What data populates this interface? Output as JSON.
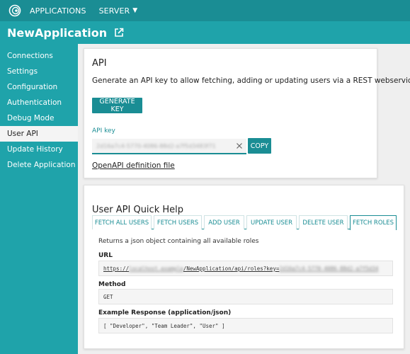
{
  "topbar": {
    "nav": [
      {
        "label": "APPLICATIONS"
      },
      {
        "label": "SERVER"
      }
    ]
  },
  "app": {
    "title": "NewApplication"
  },
  "sidebar": {
    "items": [
      {
        "label": "Connections"
      },
      {
        "label": "Settings"
      },
      {
        "label": "Configuration"
      },
      {
        "label": "Authentication"
      },
      {
        "label": "Debug Mode"
      },
      {
        "label": "User API",
        "active": true
      },
      {
        "label": "Update History"
      },
      {
        "label": "Delete Application"
      }
    ]
  },
  "api_card": {
    "heading": "API",
    "description": "Generate an API key to allow fetching, adding or updating users via a REST webservice.",
    "generate_button": "GENERATE KEY",
    "key_label": "API key",
    "key_value": "2d16a7c4-5770-4086-88d2-a7f5d3483f71",
    "copy_button": "COPY",
    "openapi_link": "OpenAPI definition file"
  },
  "quick_help": {
    "heading": "User API Quick Help",
    "tabs": [
      {
        "label": "FETCH ALL USERS"
      },
      {
        "label": "FETCH USERS"
      },
      {
        "label": "ADD USER"
      },
      {
        "label": "UPDATE USER"
      },
      {
        "label": "DELETE USER"
      },
      {
        "label": "FETCH ROLES",
        "active": true
      }
    ],
    "tab_description": "Returns a json object containing all available roles",
    "url_label": "URL",
    "url_prefix": "https://",
    "url_host_masked": "localhost.example",
    "url_path": "/NewApplication/api/roles?key=",
    "url_key_masked": "2d16a7c4-5770-4086-88d2-a7f5d34",
    "method_label": "Method",
    "method_value": "GET",
    "response_label": "Example Response (application/json)",
    "response_value": "[ \"Developer\", \"Team Leader\", \"User\" ]"
  },
  "colors": {
    "teal_dark": "#1a8d94",
    "teal": "#1fa3aa"
  }
}
